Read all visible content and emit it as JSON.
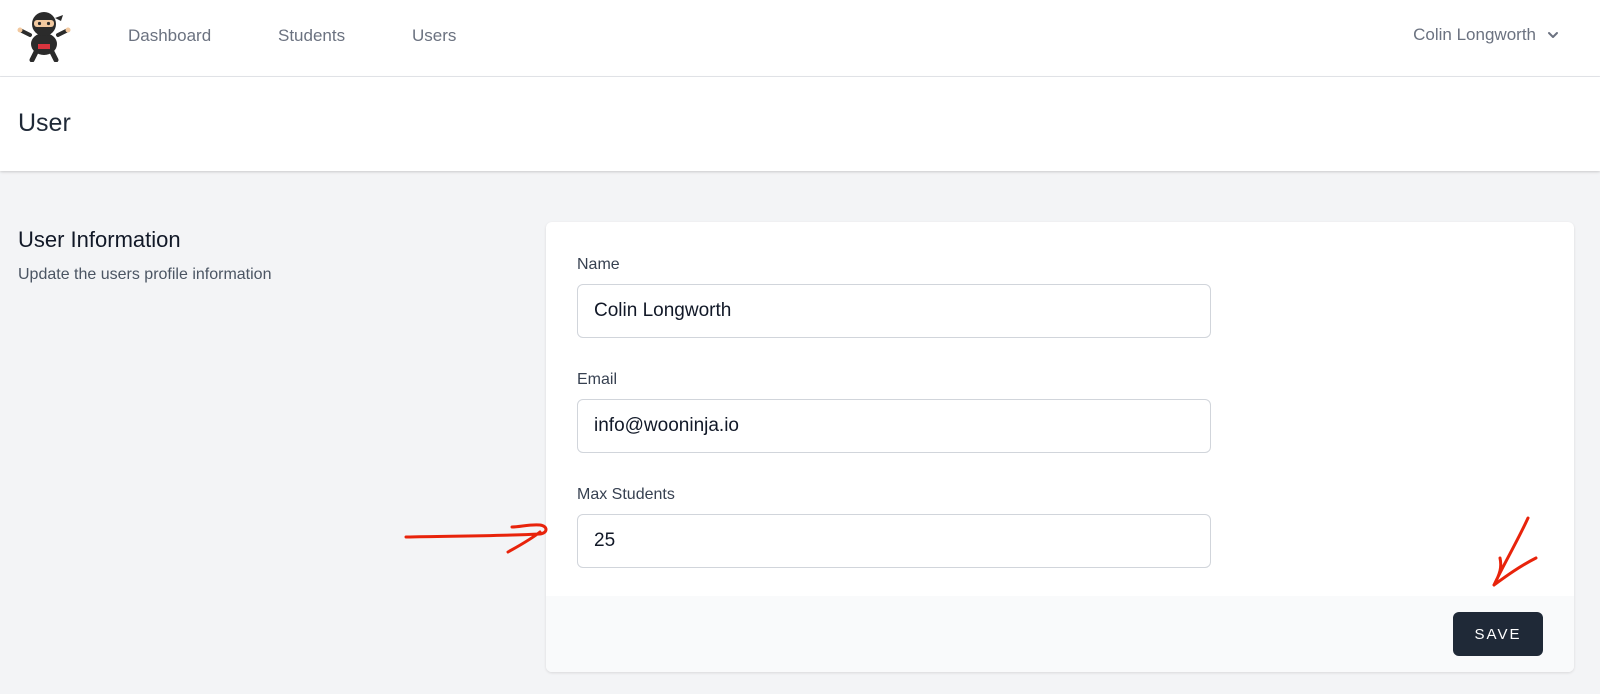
{
  "nav": {
    "links": [
      "Dashboard",
      "Students",
      "Users"
    ],
    "user_name": "Colin Longworth"
  },
  "page": {
    "title": "User"
  },
  "section": {
    "title": "User Information",
    "description": "Update the users profile information"
  },
  "form": {
    "name_label": "Name",
    "name_value": "Colin Longworth",
    "email_label": "Email",
    "email_value": "info@wooninja.io",
    "max_students_label": "Max Students",
    "max_students_value": "25",
    "save_label": "SAVE"
  },
  "colors": {
    "primary_button": "#1f2937",
    "annotation": "#e8230b"
  },
  "icons": {
    "logo": "ninja-logo-icon",
    "user_menu": "chevron-down-icon"
  }
}
